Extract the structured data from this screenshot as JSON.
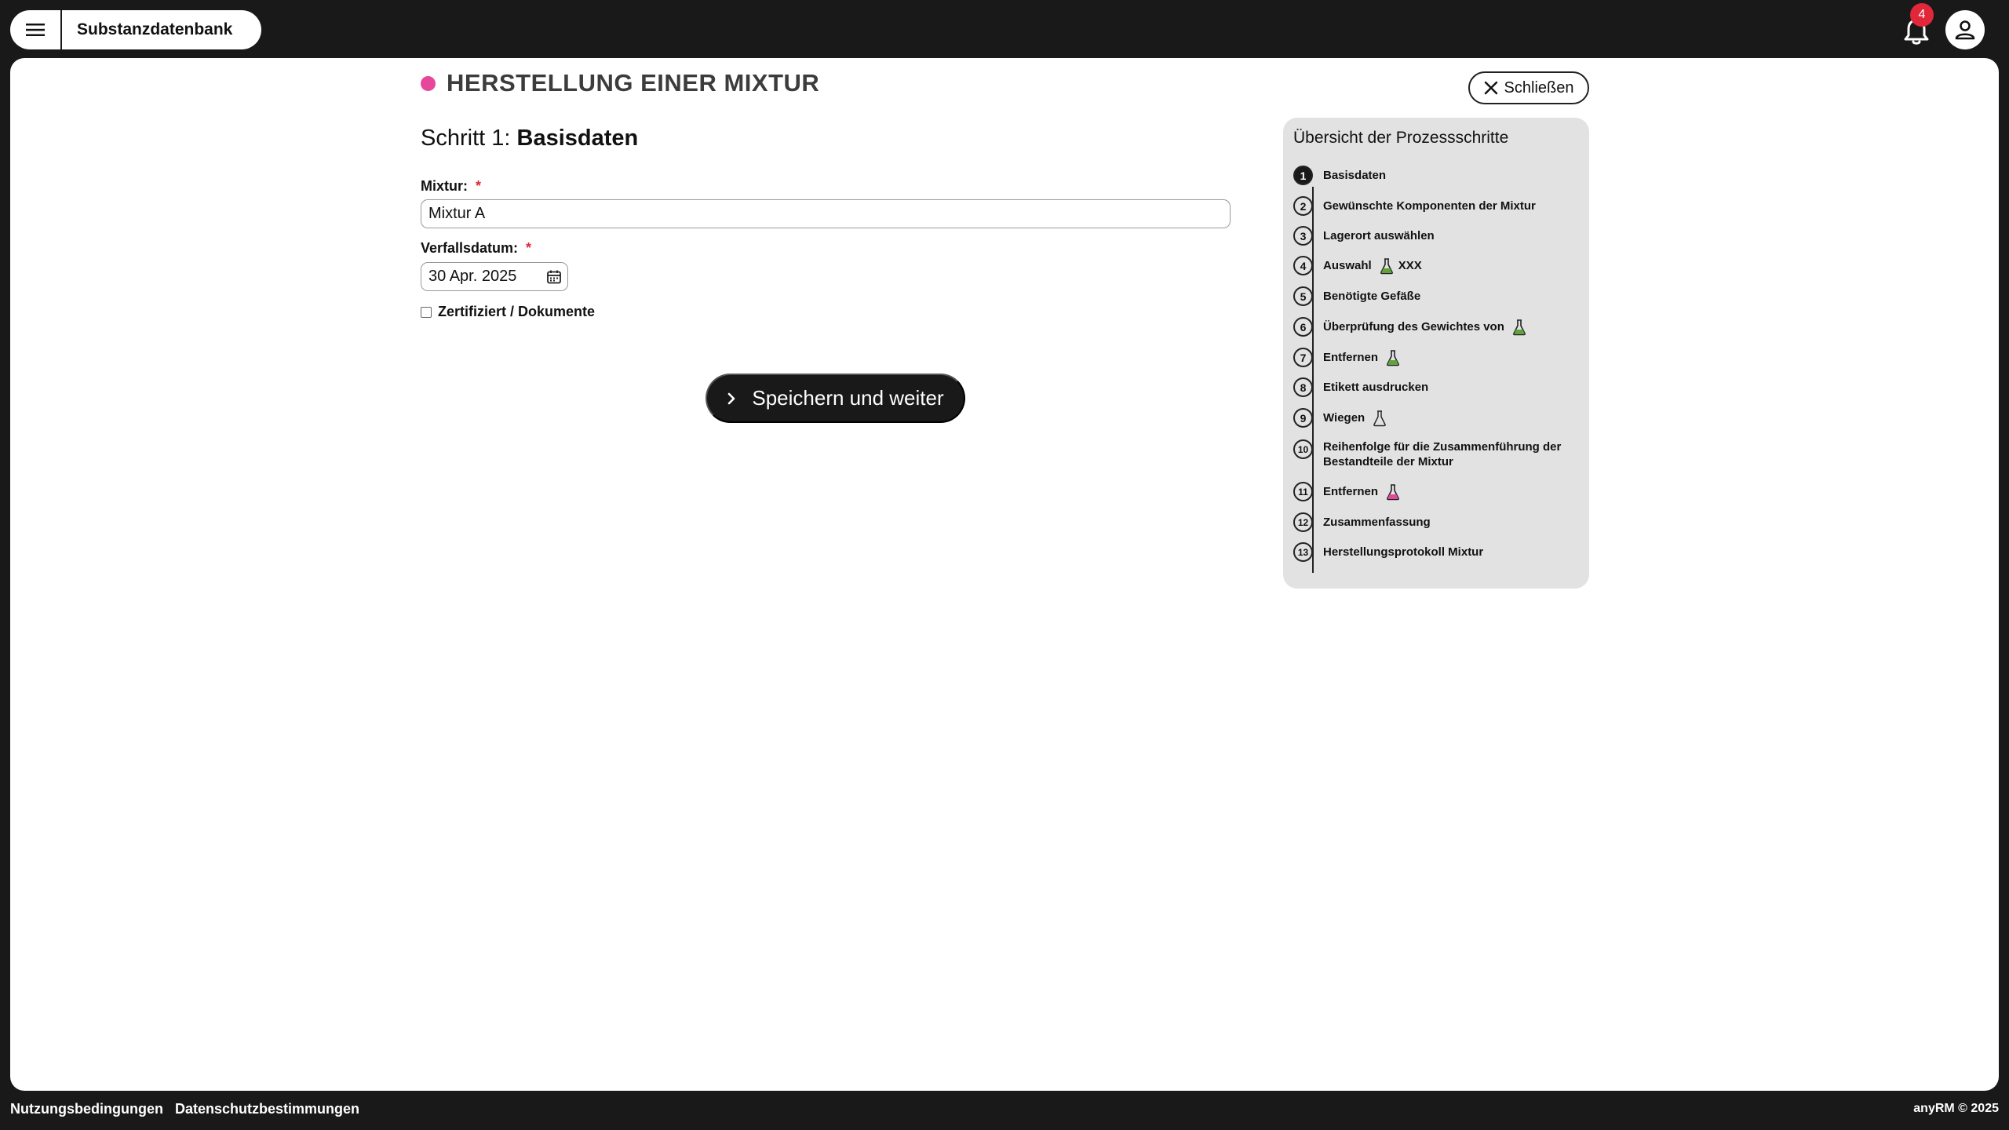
{
  "app": {
    "title": "Substanzdatenbank"
  },
  "notifications": {
    "count": "4"
  },
  "page": {
    "title": "HERSTELLUNG EINER MIXTUR",
    "close_label": "Schließen",
    "step_prefix": "Schritt 1:",
    "step_name": "Basisdaten"
  },
  "form": {
    "mixture_label": "Mixtur:",
    "mixture_value": "Mixtur A",
    "expiry_label": "Verfallsdatum:",
    "expiry_value": "30 Apr. 2025",
    "required_mark": "*",
    "certified_label": "Zertifiziert / Dokumente",
    "certified_checked": false,
    "submit_label": "Speichern und weiter"
  },
  "overview": {
    "title": "Übersicht der Prozessschritte",
    "steps": [
      {
        "num": "1",
        "label": "Basisdaten"
      },
      {
        "num": "2",
        "label": "Gewünschte Komponenten der Mixtur"
      },
      {
        "num": "3",
        "label": "Lagerort auswählen"
      },
      {
        "num": "4",
        "label": "Auswahl",
        "icon": "flask-green-icon",
        "extra": "XXX"
      },
      {
        "num": "5",
        "label": "Benötigte Gefäße"
      },
      {
        "num": "6",
        "label": "Überprüfung des Gewichtes von",
        "icon": "flask-green-icon"
      },
      {
        "num": "7",
        "label": "Entfernen",
        "icon": "flask-green-icon"
      },
      {
        "num": "8",
        "label": "Etikett ausdrucken"
      },
      {
        "num": "9",
        "label": "Wiegen",
        "icon": "flask-empty-icon"
      },
      {
        "num": "10",
        "label": "Reihenfolge für die Zusammenführung der Bestandteile der Mixtur"
      },
      {
        "num": "11",
        "label": "Entfernen",
        "icon": "flask-pink-icon"
      },
      {
        "num": "12",
        "label": "Zusammenfassung"
      },
      {
        "num": "13",
        "label": "Herstellungsprotokoll Mixtur"
      }
    ]
  },
  "colors": {
    "accent_pink": "#e6479b",
    "flask_green": "#5fa33a",
    "required_red": "#e0283a",
    "dark": "#191919"
  },
  "footer": {
    "terms": "Nutzungsbedingungen",
    "privacy": "Datenschutzbestimmungen",
    "copyright": "anyRM © 2025"
  }
}
